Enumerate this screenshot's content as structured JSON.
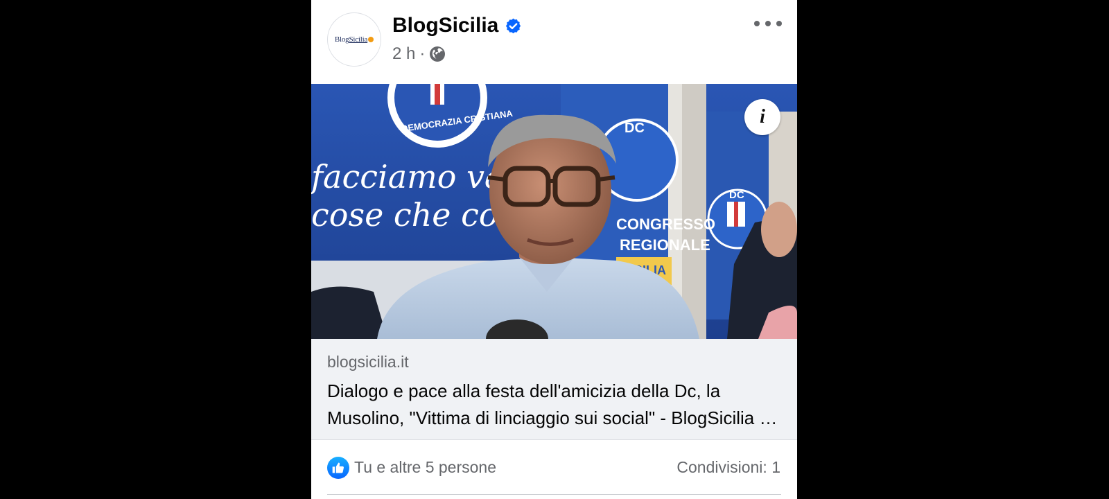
{
  "post": {
    "page_name": "BlogSicilia",
    "verified": true,
    "timestamp": "2 h",
    "separator": "·",
    "privacy_icon": "globe-icon",
    "avatar_logo": {
      "part1": "Blog",
      "part2": "Sicilia"
    },
    "media": {
      "image_description_icon": "info-icon",
      "info_label": "i",
      "banner_lines": [
        "facciamo valere",
        "cose che contano"
      ],
      "emblem_text": "DEMOCRAZIA CRISTIANA",
      "dc_label": "DC",
      "congress_text": [
        "CONGRESSO",
        "REGIONALE",
        "SICILIA"
      ]
    },
    "link": {
      "domain": "blogsicilia.it",
      "headline": "Dialogo e pace alla festa dell'amicizia della Dc, la Musolino, \"Vittima di linciaggio sui social\" - BlogSicilia - Ultime notizie dalla Sicilia"
    },
    "reactions": {
      "summary": "Tu e altre 5 persone",
      "shares": "Condivisioni: 1"
    }
  },
  "colors": {
    "background": "#000000",
    "card": "#ffffff",
    "link_box": "#f0f2f5",
    "accent_blue": "#0866ff",
    "secondary_text": "#65676b"
  }
}
